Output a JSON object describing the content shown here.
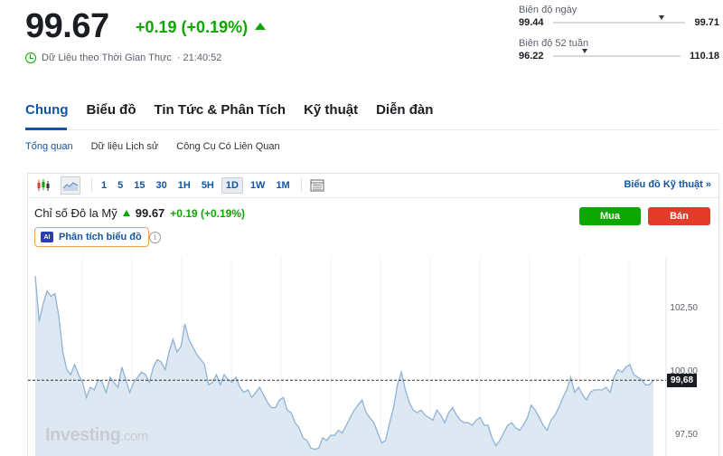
{
  "quote": {
    "price": "99.67",
    "change": "+0.19 (+0.19%)",
    "realtime_label": "Dữ Liệu theo Thời Gian Thực",
    "time": "· 21:40:52"
  },
  "day_range": {
    "label": "Biên độ ngày",
    "low": "99.44",
    "high": "99.71",
    "position": 0.82
  },
  "week52_range": {
    "label": "Biên độ 52 tuần",
    "low": "96.22",
    "high": "110.18",
    "position": 0.25
  },
  "tabs": [
    {
      "label": "Chung",
      "active": true
    },
    {
      "label": "Biểu đồ"
    },
    {
      "label": "Tin Tức & Phân Tích"
    },
    {
      "label": "Kỹ thuật"
    },
    {
      "label": "Diễn đàn"
    }
  ],
  "subtabs": [
    {
      "label": "Tổng quan",
      "active": true
    },
    {
      "label": "Dữ liệu Lịch sử"
    },
    {
      "label": "Công Cụ Có Liên Quan"
    }
  ],
  "toolbar": {
    "icons": [
      "candlestick-icon",
      "area-chart-icon"
    ],
    "timeframes": [
      "1",
      "5",
      "15",
      "30",
      "1H",
      "5H",
      "1D",
      "1W",
      "1M"
    ],
    "selected_timeframe": "1D",
    "tech_link": "Biểu đồ Kỹ thuật »"
  },
  "chart_header": {
    "name": "Chỉ số Đô la Mỹ",
    "price": "99.67",
    "change": "+0.19 (+0.19%)",
    "buy_label": "Mua",
    "sell_label": "Bán",
    "ai_badge": "AI",
    "ai_label": "Phân tích biểu đồ",
    "info_glyph": "i"
  },
  "watermark": {
    "brand": "Investing",
    "suffix": ".com"
  },
  "colors": {
    "accent": "#1256a0",
    "up": "#0ea600",
    "down": "#e23b2a",
    "line": "#8fb3d6",
    "fill": "#dde8f3"
  },
  "chart_data": {
    "type": "area",
    "yticks": [
      "102,50",
      "100,00",
      "97,50"
    ],
    "ytick_values": [
      102.5,
      100.0,
      97.5
    ],
    "ylim": [
      96.4,
      104.55
    ],
    "last_value_label": "99,68",
    "last_value": 99.68,
    "values": [
      103.8,
      102.0,
      102.7,
      103.2,
      103.0,
      103.1,
      102.2,
      100.8,
      100.1,
      99.9,
      100.3,
      99.9,
      99.6,
      99.0,
      99.4,
      99.3,
      99.7,
      99.6,
      99.2,
      99.8,
      99.6,
      99.4,
      100.2,
      99.7,
      99.2,
      99.6,
      99.8,
      100.0,
      99.9,
      99.6,
      100.2,
      100.5,
      100.4,
      100.1,
      100.8,
      101.3,
      100.8,
      101.0,
      101.9,
      101.3,
      101.0,
      100.7,
      100.5,
      100.3,
      99.5,
      99.6,
      99.9,
      99.5,
      99.9,
      99.7,
      99.6,
      99.8,
      99.4,
      99.2,
      99.3,
      99.0,
      99.2,
      99.4,
      99.1,
      98.8,
      98.6,
      98.6,
      98.9,
      99.0,
      98.5,
      98.4,
      98.0,
      97.8,
      97.4,
      97.3,
      97.0,
      96.95,
      97.0,
      97.4,
      97.3,
      97.5,
      97.5,
      97.7,
      97.6,
      97.9,
      98.2,
      98.5,
      98.7,
      98.9,
      98.4,
      98.2,
      98.0,
      97.6,
      97.2,
      97.3,
      98.0,
      98.6,
      99.5,
      100.0,
      99.3,
      98.8,
      98.5,
      98.4,
      98.5,
      98.3,
      98.2,
      98.1,
      98.5,
      98.3,
      98.0,
      98.4,
      98.6,
      98.3,
      98.1,
      98.0,
      98.0,
      97.9,
      98.1,
      98.2,
      97.9,
      97.9,
      97.4,
      97.1,
      97.3,
      97.6,
      97.9,
      98.0,
      97.8,
      97.7,
      97.9,
      98.2,
      98.7,
      98.5,
      98.2,
      97.9,
      97.7,
      98.1,
      98.3,
      98.6,
      99.0,
      99.3,
      99.8,
      99.2,
      99.4,
      99.1,
      98.9,
      99.2,
      99.3,
      99.3,
      99.3,
      99.4,
      99.2,
      99.8,
      100.1,
      100.0,
      100.2,
      100.3,
      99.9,
      99.8,
      99.7,
      99.5,
      99.5,
      99.68
    ]
  }
}
